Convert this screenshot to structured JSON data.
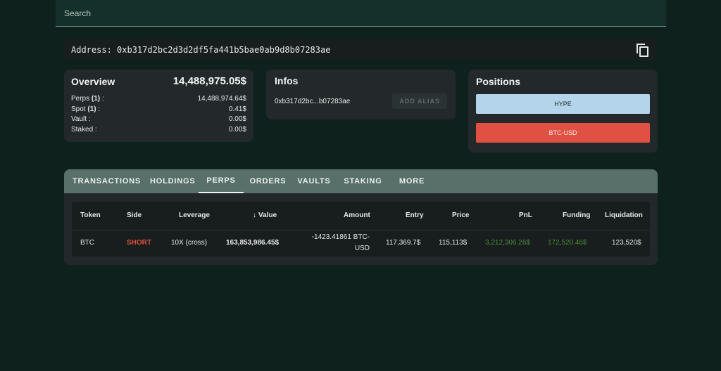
{
  "search": {
    "placeholder": "Search"
  },
  "address": {
    "label": "Address: 0xb317d2bc2d3d2df5fa441b5bae0ab9d8b07283ae"
  },
  "overview": {
    "title": "Overview",
    "total": "14,488,975.05$",
    "rows": [
      {
        "label": "Perps",
        "count": "(1)",
        "suffix": " :",
        "value": "14,488,974.64$"
      },
      {
        "label": "Spot",
        "count": "(1)",
        "suffix": " :",
        "value": "0.41$"
      },
      {
        "label": "Vault :",
        "count": "",
        "suffix": "",
        "value": "0.00$"
      },
      {
        "label": "Staked :",
        "count": "",
        "suffix": "",
        "value": "0.00$"
      }
    ]
  },
  "infos": {
    "title": "Infos",
    "short_address": "0xb317d2bc...b07283ae",
    "alias_button": "ADD ALIAS"
  },
  "positions": {
    "title": "Positions",
    "items": [
      "HYPE",
      "BTC-USD"
    ]
  },
  "tabs": [
    "TRANSACTIONS",
    "HOLDINGS",
    "PERPS",
    "ORDERS",
    "VAULTS",
    "STAKING",
    "MORE"
  ],
  "active_tab": "PERPS",
  "table": {
    "columns": [
      "Token",
      "Side",
      "Leverage",
      "Value",
      "Amount",
      "Entry",
      "Price",
      "PnL",
      "Funding",
      "Liquidation"
    ],
    "row": {
      "token": "BTC",
      "side": "SHORT",
      "leverage": "10X (cross)",
      "value": "163,853,986.45$",
      "amount_line1": "-1423.41861 BTC-",
      "amount_line2": "USD",
      "entry": "117,369.7$",
      "price": "115,113$",
      "pnl": "3,212,306.26$",
      "funding": "172,520.46$",
      "liquidation": "123,520$"
    }
  },
  "colors": {
    "short": "#e05043",
    "positive": "#4f8a3c",
    "hype_button": "#b3d4ea",
    "btc_button": "#e05043"
  }
}
